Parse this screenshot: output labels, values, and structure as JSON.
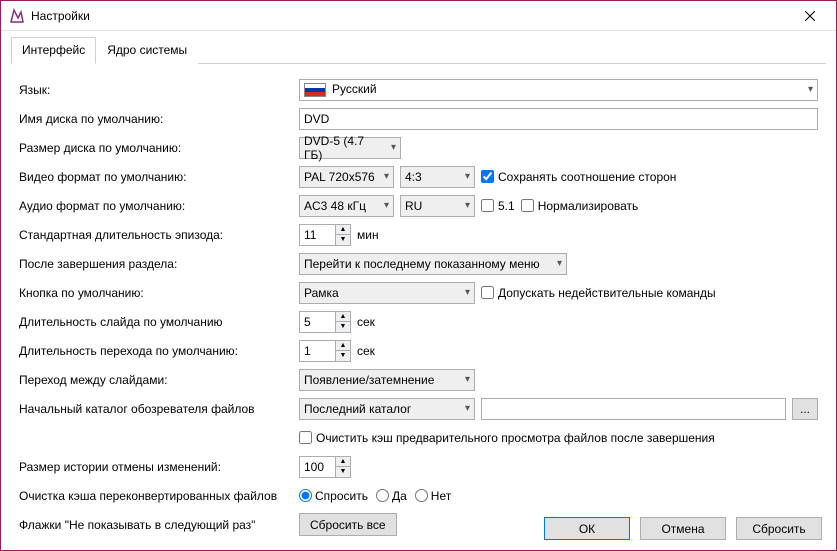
{
  "window": {
    "title": "Настройки"
  },
  "tabs": {
    "interface": "Интерфейс",
    "core": "Ядро системы"
  },
  "labels": {
    "language": "Язык:",
    "disc_name": "Имя диска по умолчанию:",
    "disc_size": "Размер диска по умолчанию:",
    "video_fmt": "Видео формат по умолчанию:",
    "audio_fmt": "Аудио формат по умолчанию:",
    "episode_len": "Стандартная длительность эпизода:",
    "after_title": "После завершения раздела:",
    "default_btn": "Кнопка по умолчанию:",
    "slide_dur": "Длительность слайда по умолчанию",
    "trans_dur": "Длительность перехода по умолчанию:",
    "slide_trans": "Переход между слайдами:",
    "init_dir": "Начальный каталог обозревателя файлов",
    "undo_hist": "Размер истории отмены изменений:",
    "clear_cache": "Очистка кэша переконвертированных файлов",
    "dont_show": "Флажки \"Не показывать в следующий раз\""
  },
  "values": {
    "language": "Русский",
    "disc_name": "DVD",
    "disc_size": "DVD-5 (4.7 ГБ)",
    "video_fmt": "PAL 720x576",
    "aspect": "4:3",
    "keep_aspect": "Сохранять соотношение сторон",
    "audio_fmt": "AC3 48 кГц",
    "audio_lang": "RU",
    "audio_51": "5.1",
    "normalize": "Нормализировать",
    "episode_len": "11",
    "minutes": "мин",
    "after_title": "Перейти к последнему показанному меню",
    "default_btn": "Рамка",
    "allow_invalid": "Допускать недействительные команды",
    "slide_dur": "5",
    "trans_dur": "1",
    "seconds": "сек",
    "slide_trans": "Появление/затемнение",
    "init_dir": "Последний каталог",
    "init_dir_path": "",
    "browse": "...",
    "clear_thumb": "Очистить кэш предварительного просмотра файлов после завершения",
    "undo_hist": "100",
    "radio_ask": "Спросить",
    "radio_yes": "Да",
    "radio_no": "Нет",
    "reset_all": "Сбросить все"
  },
  "footer": {
    "ok": "ОК",
    "cancel": "Отмена",
    "reset": "Сбросить"
  }
}
